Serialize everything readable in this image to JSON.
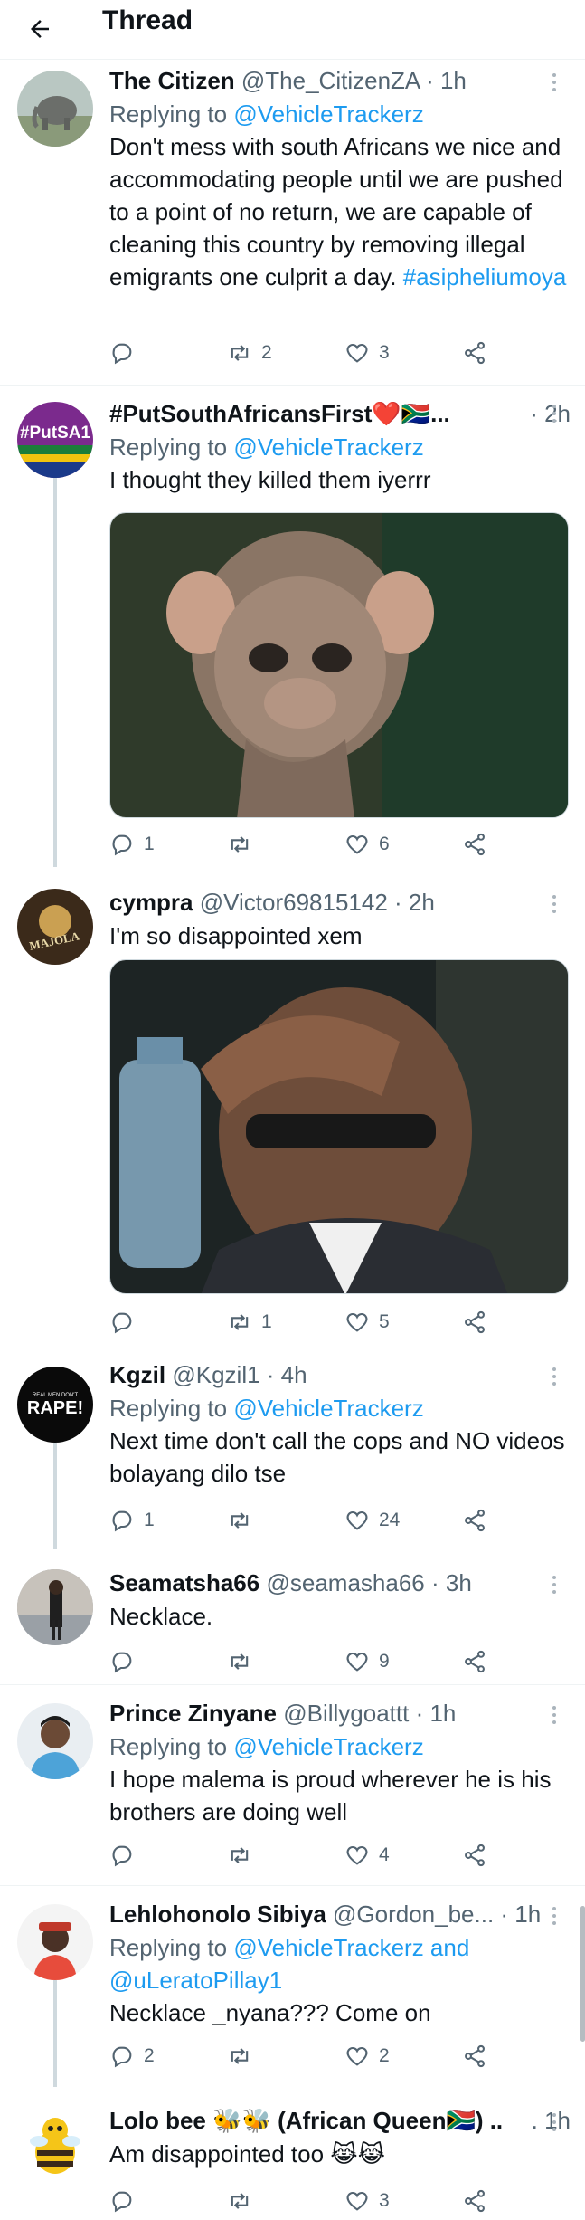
{
  "header": {
    "title": "Thread"
  },
  "tweets": [
    {
      "name": "The Citizen",
      "handle": "@The_CitizenZA",
      "time": "· 1h",
      "replying_prefix": "Replying to ",
      "replying_to": "@VehicleTrackerz",
      "text": "Don't mess with south Africans we nice and accommodating people until we are pushed to a point of no return, we are capable of cleaning this country by removing illegal emigrants one culprit a day. ",
      "hashtag": "#asipheliumoya",
      "replies": "",
      "retweets": "2",
      "likes": "3"
    },
    {
      "name": "#PutSouthAfricansFirst❤️🇿🇦...",
      "handle": "",
      "time": "· 2h",
      "avatar_text": "#PutSA1",
      "replying_prefix": "Replying to ",
      "replying_to": "@VehicleTrackerz",
      "text": "I thought they killed them iyerrr",
      "replies": "1",
      "retweets": "",
      "likes": "6"
    },
    {
      "name": "cympra",
      "handle": "@Victor69815142",
      "time": "· 2h",
      "avatar_text": "MAJOLA",
      "text": "I'm so disappointed xem",
      "replies": "",
      "retweets": "1",
      "likes": "5"
    },
    {
      "name": "Kgzil",
      "handle": "@Kgzil1",
      "time": "· 4h",
      "avatar_top": "REAL MEN DON'T",
      "avatar_main": "RAPE!",
      "replying_prefix": "Replying to ",
      "replying_to": "@VehicleTrackerz",
      "text": "Next time don't call the cops and NO videos bolayang dilo tse",
      "replies": "1",
      "retweets": "",
      "likes": "24"
    },
    {
      "name": "Seamatsha66",
      "handle": "@seamasha66",
      "time": "· 3h",
      "text": "Necklace.",
      "replies": "",
      "retweets": "",
      "likes": "9"
    },
    {
      "name": "Prince Zinyane",
      "handle": "@Billygoattt",
      "time": "· 1h",
      "replying_prefix": "Replying to ",
      "replying_to": "@VehicleTrackerz",
      "text": "I hope malema is proud wherever he is his brothers are doing well",
      "replies": "",
      "retweets": "",
      "likes": "4"
    },
    {
      "name": "Lehlohonolo Sibiya",
      "handle": "@Gordon_be...",
      "time": "· 1h",
      "replying_prefix": "Replying to ",
      "replying_to": "@VehicleTrackerz and @uLeratoPillay1",
      "text": "Necklace _nyana??? Come on",
      "replies": "2",
      "retweets": "",
      "likes": "2"
    },
    {
      "name": "Lolo bee 🐝🐝 (African Queen🇿🇦) ..",
      "handle": "",
      "time": ". 1h",
      "text": "Am disappointed too 😹😹",
      "replies": "",
      "retweets": "",
      "likes": "3"
    }
  ],
  "colors": {
    "accent": "#1d9bf0",
    "muted": "#536471",
    "divider": "#eff3f4"
  }
}
